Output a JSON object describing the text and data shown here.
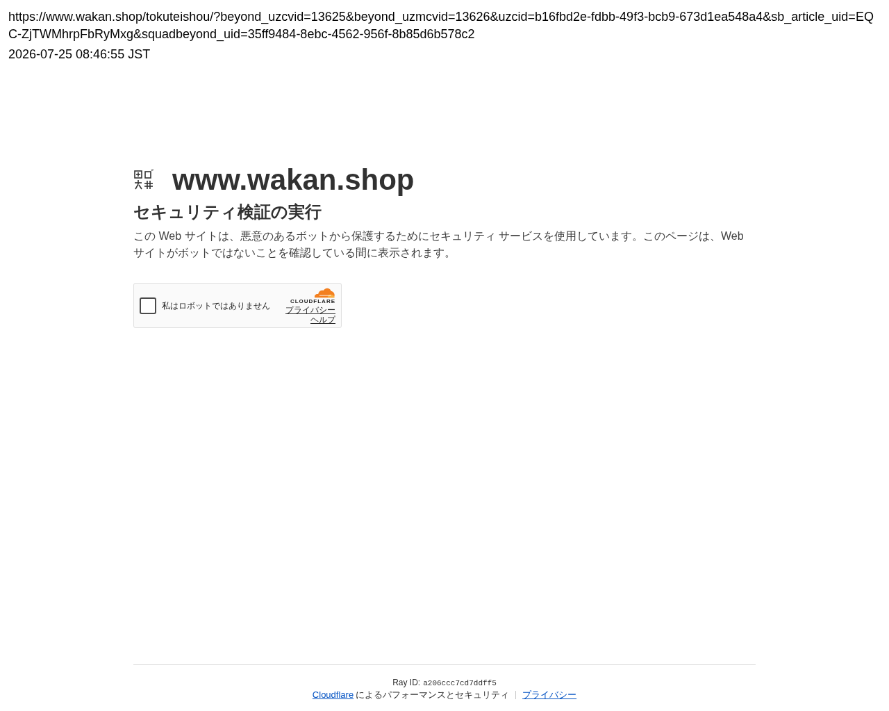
{
  "capture": {
    "url": "https://www.wakan.shop/tokuteishou/?beyond_uzcvid=13625&beyond_uzmcvid=13626&uzcid=b16fbd2e-fdbb-49f3-bcb9-673d1ea548a4&sb_article_uid=EQC-ZjTWMhrpFbRyMxg&squadbeyond_uid=35ff9484-8ebc-4562-956f-8b85d6b578c2",
    "timestamp": "2026-07-25 08:46:55 JST"
  },
  "site": {
    "name": "www.wakan.shop"
  },
  "heading": "セキュリティ検証の実行",
  "description": "この Web サイトは、悪意のあるボットから保護するためにセキュリティ サービスを使用しています。このページは、Web サイトがボットではないことを確認している間に表示されます。",
  "challenge": {
    "checkbox": {
      "label": "私はロボットではありません",
      "checked": false
    },
    "brand": "CLOUDFLARE",
    "links": [
      "プライバシー",
      "ヘルプ"
    ]
  },
  "footer": {
    "ray_id_label": "Ray ID:",
    "ray_id": "a206ccc7cd7ddff5",
    "provider_link": "Cloudflare",
    "provider_text": "によるパフォーマンスとセキュリティ",
    "privacy_link": "プライバシー"
  }
}
